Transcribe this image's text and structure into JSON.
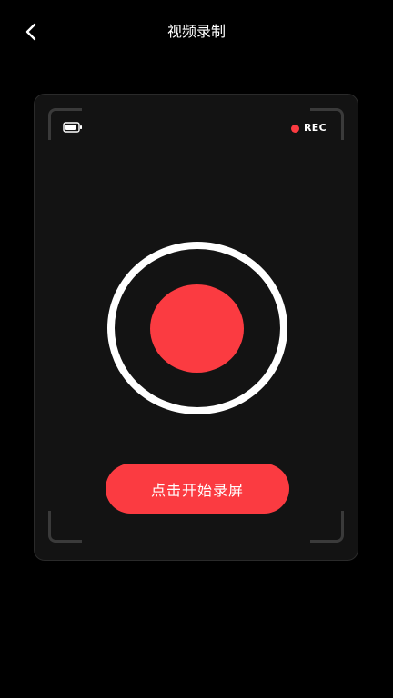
{
  "header": {
    "back_icon": "chevron-left-icon",
    "title": "视频录制"
  },
  "viewfinder": {
    "battery_icon": "battery-icon",
    "rec_label": "REC",
    "record_button_icon": "record-icon",
    "start_button_label": "点击开始录屏"
  },
  "colors": {
    "background": "#000000",
    "panel": "#131313",
    "accent_red": "#fb3b41",
    "ring": "#ffffff"
  }
}
